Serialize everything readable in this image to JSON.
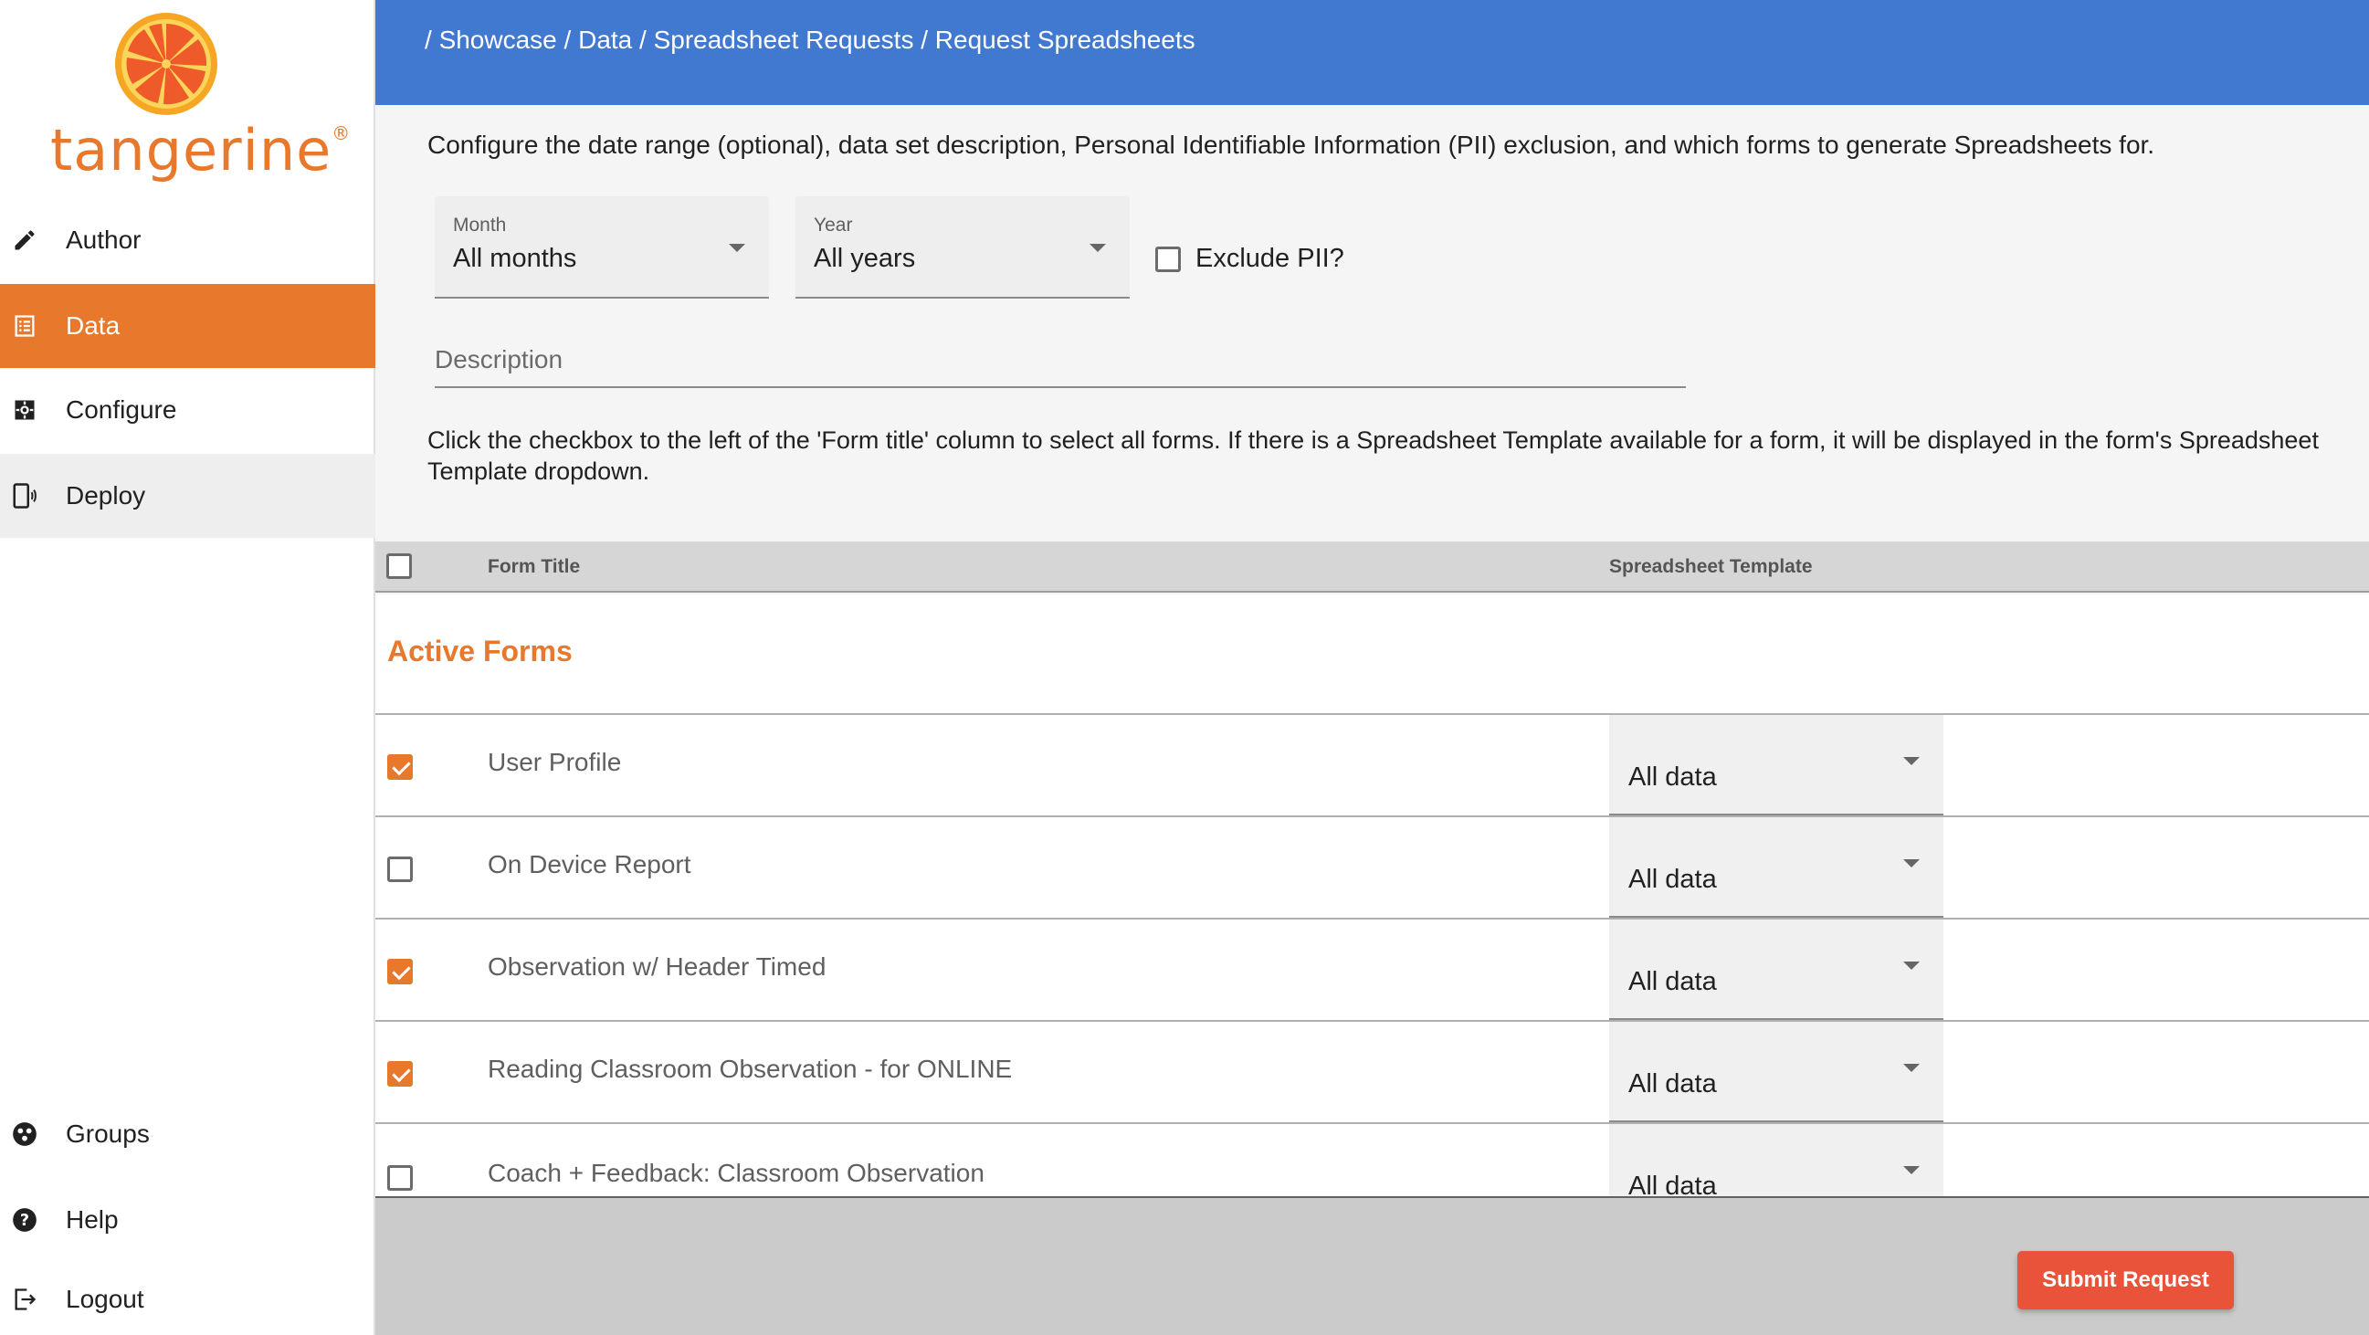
{
  "app": {
    "name": "tangerine",
    "reg_mark": "®",
    "brand_color": "#e8782b",
    "header_color": "#4079cf",
    "submit_color": "#e8533a"
  },
  "sidebar": {
    "items": [
      {
        "label": "Author",
        "icon": "pencil-icon"
      },
      {
        "label": "Data",
        "icon": "list-icon",
        "active": true
      },
      {
        "label": "Configure",
        "icon": "settings-icon"
      },
      {
        "label": "Deploy",
        "icon": "deploy-device-icon"
      }
    ],
    "bottom_items": [
      {
        "label": "Groups",
        "icon": "groups-icon"
      },
      {
        "label": "Help",
        "icon": "help-icon"
      },
      {
        "label": "Logout",
        "icon": "logout-icon"
      }
    ]
  },
  "header": {
    "breadcrumb": [
      "Showcase",
      "Data",
      "Spreadsheet Requests",
      "Request Spreadsheets"
    ],
    "separator": "/"
  },
  "main": {
    "intro": "Configure the date range (optional), data set description, Personal Identifiable Information (PII) exclusion, and which forms to generate Spreadsheets for.",
    "month": {
      "label": "Month",
      "value": "All months"
    },
    "year": {
      "label": "Year",
      "value": "All years"
    },
    "exclude_pii": {
      "label": "Exclude PII?",
      "checked": false
    },
    "description": {
      "placeholder": "Description",
      "value": ""
    },
    "hint": "Click the checkbox to the left of the 'Form title' column to select all forms. If there is a Spreadsheet Template available for a form, it will be displayed in the form's Spreadsheet Template dropdown."
  },
  "table": {
    "headers": {
      "form_title": "Form Title",
      "template": "Spreadsheet Template"
    },
    "select_all_checked": false,
    "section_title": "Active Forms",
    "rows": [
      {
        "title": "User Profile",
        "checked": true,
        "template": "All data"
      },
      {
        "title": "On Device Report",
        "checked": false,
        "template": "All data"
      },
      {
        "title": "Observation w/ Header Timed",
        "checked": true,
        "template": "All data"
      },
      {
        "title": "Reading Classroom Observation - for ONLINE",
        "checked": true,
        "template": "All data"
      },
      {
        "title": "Coach + Feedback: Classroom Observation",
        "checked": false,
        "template": "All data"
      }
    ]
  },
  "footer": {
    "submit_label": "Submit Request"
  }
}
